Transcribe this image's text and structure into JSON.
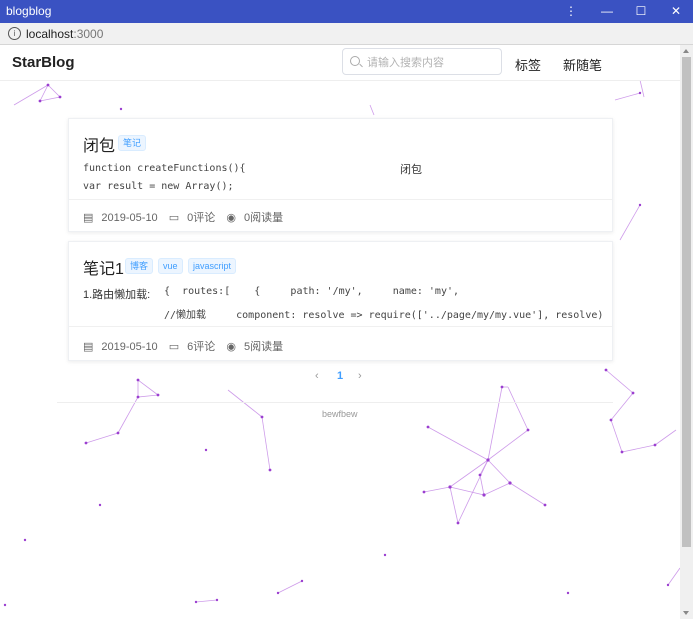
{
  "window": {
    "title": "blogblog",
    "controls": [
      "⋮",
      "—",
      "☐",
      "✕"
    ]
  },
  "address": {
    "host": "localhost",
    "port": ":3000"
  },
  "header": {
    "brand": "StarBlog",
    "search_placeholder": "请输入搜索内容",
    "nav": [
      "标签",
      "新随笔"
    ]
  },
  "posts": [
    {
      "title": "闭包",
      "tags": [
        "笔记"
      ],
      "excerpt_left": [
        "function createFunctions(){",
        "var result = new Array();"
      ],
      "excerpt_right": "闭包",
      "date": "2019-05-10",
      "comments": "0评论",
      "views": "0阅读量"
    },
    {
      "title": "笔记1",
      "tags": [
        "博客",
        "vue",
        "javascript"
      ],
      "excerpt_label": "1.路由懒加载:",
      "excerpt_lines": [
        "{  routes:[    {     path: '/my',     name: 'my',",
        "//懒加载     component: resolve => require(['../page/my/my.vue'], resolve)"
      ],
      "date": "2019-05-10",
      "comments": "6评论",
      "views": "5阅读量"
    }
  ],
  "pagination": {
    "prev": "‹",
    "current": "1",
    "next": "›"
  },
  "footer": {
    "text": "bewfbew"
  },
  "colors": {
    "titlebar": "#3a52c2",
    "accent": "#409eff",
    "particle": "#b04fd6"
  }
}
